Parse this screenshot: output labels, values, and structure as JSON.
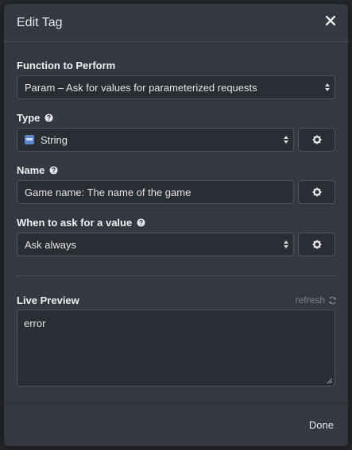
{
  "dialog": {
    "title": "Edit Tag",
    "close_icon": "close-icon"
  },
  "function_field": {
    "label": "Function to Perform",
    "value": "Param – Ask for values for parameterized requests"
  },
  "type_field": {
    "label": "Type",
    "value": "String",
    "icon": "string-type-icon"
  },
  "name_field": {
    "label": "Name",
    "value": "Game name: The name of the game"
  },
  "ask_field": {
    "label": "When to ask for a value",
    "value": "Ask always"
  },
  "live_preview": {
    "label": "Live Preview",
    "refresh_label": "refresh",
    "content": "error"
  },
  "footer": {
    "done_label": "Done"
  },
  "colors": {
    "modal_bg": "#343840",
    "field_bg": "#2a2d33",
    "border": "#50545c",
    "muted_text": "#7b818b"
  }
}
